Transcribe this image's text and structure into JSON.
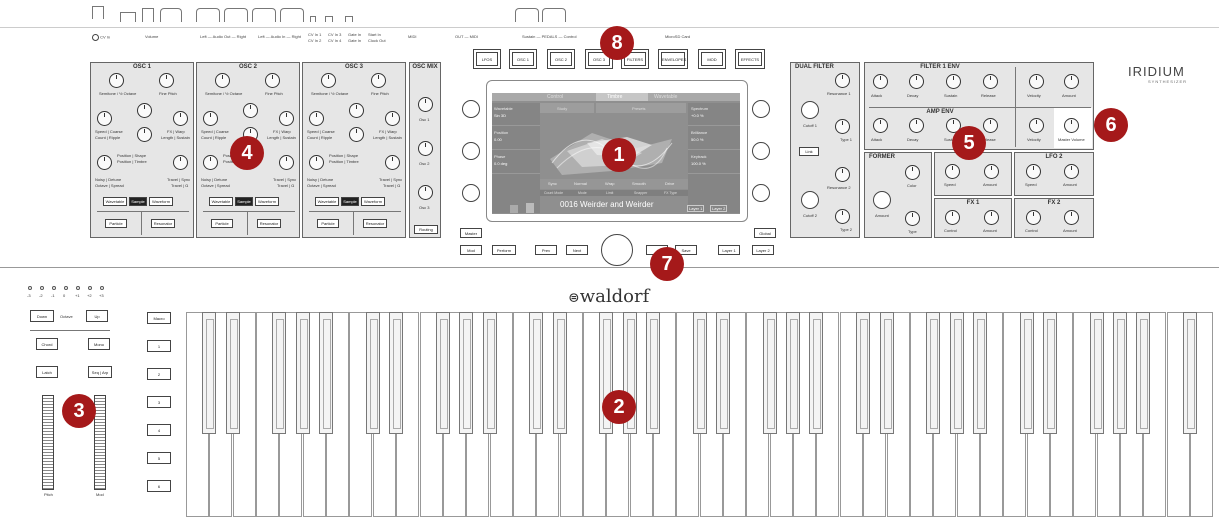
{
  "brand": {
    "logo_text": "waldorf",
    "model": "IRIDIUM",
    "model_sub": "SYNTHESIZER"
  },
  "connectors": {
    "cv_in": "CV In",
    "volume": "Volume",
    "out1": "Left  — Audio Out —  Right",
    "out2": "Left  — Audio In —  Right",
    "cv1": "CV In 1",
    "cv2": "CV In 2",
    "cv3": "CV In 3",
    "cv4": "CV In 4",
    "gate1": "Gate In",
    "gate2": "Gate In",
    "start": "Start In",
    "clock": "Clock Out",
    "midi_in": "MIDI",
    "midi_out": "OUT — MIDI",
    "sustain": "Sustain — PEDALS — Control",
    "controller": "Controller",
    "microsd": "MicroSD Card"
  },
  "osc_panels": [
    {
      "title": "OSC 1",
      "labels": [
        "Semitone / ½ Octave",
        "Fine Pitch",
        "Speed | Coarse",
        "Count | Ripple",
        "FX | Warp",
        "Length | Sustain",
        "Position | Shape",
        "Position | Timbre",
        "Noisy | Detune",
        "Octave | Spread",
        "Travel | Sync",
        "Travel | Ω"
      ],
      "btn_wavetable": "Wavetable",
      "btn_sample": "Sample",
      "btn_waveform": "Waveform",
      "btn_particle": "Particle",
      "btn_resonator": "Resonator"
    },
    {
      "title": "OSC 2",
      "labels": [
        "Semitone / ½ Octave",
        "Fine Pitch",
        "Speed | Coarse",
        "Count | Ripple",
        "FX | Warp",
        "Length | Sustain",
        "Position | Shape",
        "Position | Timbre",
        "Noisy | Detune",
        "Octave | Spread",
        "Travel | Sync",
        "Travel | Ω"
      ],
      "btn_wavetable": "Wavetable",
      "btn_sample": "Sample",
      "btn_waveform": "Waveform",
      "btn_particle": "Particle",
      "btn_resonator": "Resonator"
    },
    {
      "title": "OSC 3",
      "labels": [
        "Semitone / ½ Octave",
        "Fine Pitch",
        "Speed | Coarse",
        "Count | Ripple",
        "FX | Warp",
        "Length | Sustain",
        "Position | Shape",
        "Position | Timbre",
        "Noisy | Detune",
        "Octave | Spread",
        "Travel | Sync",
        "Travel | Ω"
      ],
      "btn_wavetable": "Wavetable",
      "btn_sample": "Sample",
      "btn_waveform": "Waveform",
      "btn_particle": "Particle",
      "btn_resonator": "Resonator"
    }
  ],
  "osc_mix": {
    "title": "OSC MIX",
    "labels": [
      "Osc 1",
      "Osc 2",
      "Osc 3"
    ],
    "routing": "Routing"
  },
  "selectors": [
    "LFOS",
    "OSC 1",
    "OSC 2",
    "OSC 3",
    "FILTERS",
    "ENVELOPES",
    "MOD",
    "EFFECTS"
  ],
  "screen": {
    "tabs": [
      "Control",
      "Timbre",
      "Wavetable"
    ],
    "left_rows": [
      {
        "label": "Wavetable",
        "value": "Sin 3D"
      },
      {
        "label": "Position",
        "value": "0.00"
      },
      {
        "label": "Phase",
        "value": "0.0 deg"
      }
    ],
    "right_rows": [
      {
        "label": "Spectrum",
        "value": "+0.0 %"
      },
      {
        "label": "Brilliance",
        "value": "50.0 %"
      },
      {
        "label": "Keytrack",
        "value": "100.0 %"
      }
    ],
    "center_tabs": [
      "Study",
      "Presets"
    ],
    "bottom_row1": [
      "Sync",
      "Normal",
      "Wrap",
      "Smooth",
      "Drive"
    ],
    "bottom_row2": [
      "Count Mode",
      "Mode",
      "Limit",
      "Snapper",
      "FX Type"
    ],
    "patch_name": "0016 Weirder and Weirder",
    "layers": [
      "Layer 1",
      "Layer 2"
    ]
  },
  "under_screen": {
    "master": "Master",
    "global": "Global",
    "mod": "Mod",
    "perform": "Perform",
    "prev": "Prev",
    "next": "Next",
    "save": "Save",
    "layer1": "Layer 1",
    "layer2": "Layer 2"
  },
  "dual_filter": {
    "title": "DUAL FILTER",
    "labels": [
      "Resonance 1",
      "Cutoff 1",
      "Type 1",
      "Link",
      "Resonance 2",
      "Cutoff 2",
      "Type 2"
    ]
  },
  "filter_env": {
    "title": "FILTER 1 ENV",
    "labels": [
      "Attack",
      "Decay",
      "Sustain",
      "Release",
      "Velocity",
      "Amount"
    ]
  },
  "amp_env": {
    "title": "AMP ENV",
    "labels": [
      "Attack",
      "Decay",
      "Sustain",
      "Release",
      "Velocity",
      "Master Volume"
    ]
  },
  "former": {
    "title": "FORMER",
    "labels": [
      "Color",
      "Amount",
      "Type"
    ]
  },
  "lfo1": {
    "labels": [
      "Speed",
      "Amount"
    ]
  },
  "lfo2": {
    "title": "LFO 2",
    "labels": [
      "Speed",
      "Amount"
    ]
  },
  "fx1": {
    "title": "FX 1",
    "labels": [
      "Control",
      "Amount"
    ]
  },
  "fx2": {
    "title": "FX 2",
    "labels": [
      "Control",
      "Amount"
    ]
  },
  "left_controls": {
    "octave_leds": [
      "-3",
      "-2",
      "-1",
      "0",
      "+1",
      "+2",
      "+3"
    ],
    "down": "Down",
    "octave": "Octave",
    "up": "Up",
    "chord": "Chord",
    "mono": "Mono",
    "latch": "Latch",
    "seq_arp": "Seq | Arp",
    "pitch": "Pitch",
    "mod": "Mod",
    "macro": "Macro",
    "macros": [
      "1",
      "2",
      "3",
      "4",
      "5",
      "6"
    ]
  },
  "callouts": [
    "1",
    "2",
    "3",
    "4",
    "5",
    "6",
    "7",
    "8"
  ]
}
